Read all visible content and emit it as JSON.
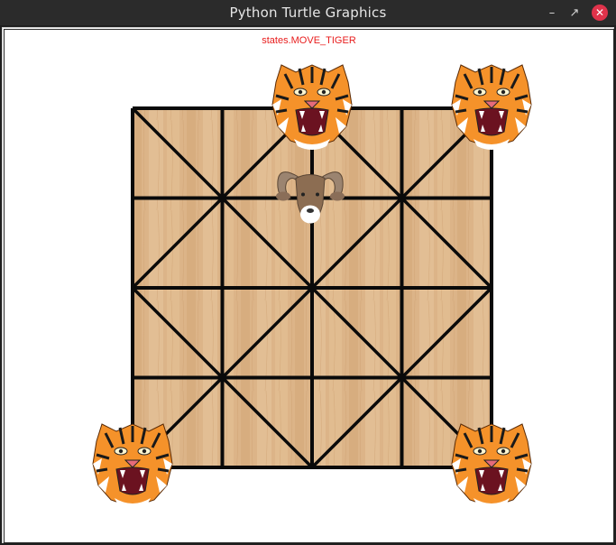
{
  "window": {
    "title": "Python Turtle Graphics",
    "buttons": {
      "minimize_icon": "minimize-icon",
      "restore_icon": "restore-icon",
      "close_icon": "close-icon"
    }
  },
  "canvas": {
    "status_text": "states.MOVE_TIGER",
    "status_color": "#e81c1c"
  },
  "board": {
    "grid_cells": 4,
    "wood_color": "#dcb488",
    "line_color": "#0a0a0a"
  },
  "pieces": {
    "tigers": [
      {
        "name": "tiger",
        "row": 0,
        "col": 2
      },
      {
        "name": "tiger",
        "row": 0,
        "col": 4
      },
      {
        "name": "tiger",
        "row": 4,
        "col": 0
      },
      {
        "name": "tiger",
        "row": 4,
        "col": 4
      }
    ],
    "goats": [
      {
        "name": "goat",
        "row": 1,
        "col": 2
      }
    ]
  }
}
